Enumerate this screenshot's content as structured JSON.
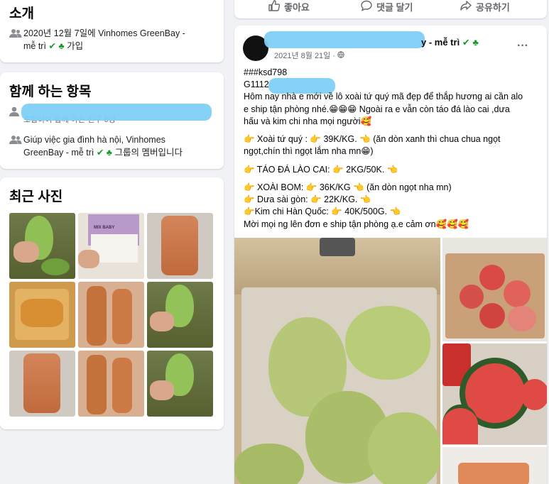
{
  "left": {
    "intro": {
      "title": "소개",
      "joined_line1": "2020년 12월 7일에 Vinhomes GreenBay -",
      "joined_line2_a": "mễ trì",
      "joined_line2_b": "가입"
    },
    "shared": {
      "title": "함께 하는 항목",
      "friends_line": "포함하여 함께 아는 친구 6명",
      "group_line1": "Giúp việc gia đình hà nội, Vinhomes",
      "group_line2_a": "GreenBay - mễ trì",
      "group_line2_b": "그룹의 멤버입니다"
    },
    "photos": {
      "title": "최근 사진",
      "mix_label": "MIX BABY"
    }
  },
  "topbar": {
    "like": "좋아요",
    "comment": "댓글 달기",
    "share": "공유하기"
  },
  "post": {
    "author_suffix": "y - mễ trì",
    "date": "2021년 8월 21일 ·",
    "more": "···",
    "lines": [
      "###ksd798",
      "G1112",
      "Hôm nay nhà e mới về lô xoài tứ quý mã đẹp để thắp hương ai cần alo",
      "e ship tận phòng nhé.😁😁😁 Ngoài ra e vẫn còn táo đá lào cai ,dưa",
      "hấu và kim chi nha mọi người🥰",
      "👉 Xoài tứ quý :  👉 39K/KG.  👈  (ăn dòn xanh thì chua chua ngọt",
      "ngọt,chín thì ngọt lắm nha mn😁)",
      "👉 TÁO ĐÁ LÀO CAI:  👉 2KG/50K.  👈",
      "👉 XOÀI BOM:  👉 36K/KG   👈  (ăn dòn ngọt nha mn)",
      "👉 Dưa sài gòn:  👉 22K/KG.  👈",
      "👉Kim chi Hàn Quốc:  👉 40K/500G.  👈",
      "Mời mọi ng lên đơn e ship tận phòng ạ.e cảm ơn🥰🥰🥰"
    ]
  },
  "colors": {
    "fb_bg": "#f0f2f5",
    "card": "#ffffff",
    "redaction": "#7fd0f5",
    "check_green": "#1a9a2a"
  }
}
